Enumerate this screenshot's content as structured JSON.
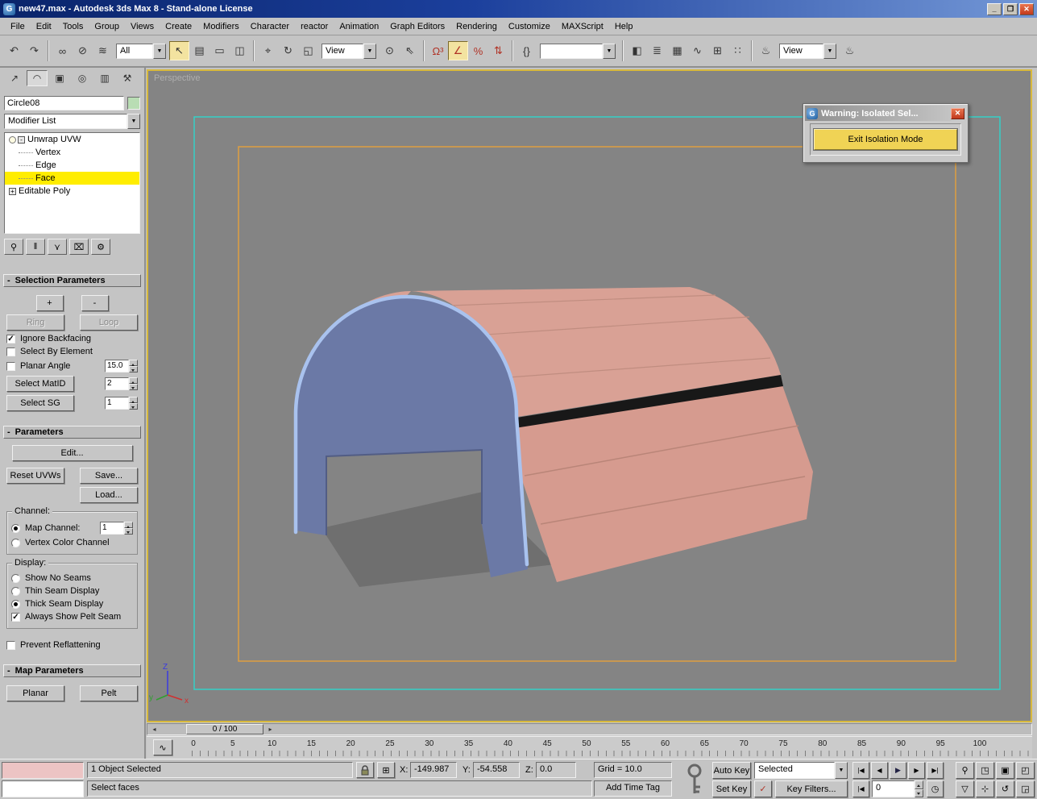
{
  "window": {
    "title": "new47.max - Autodesk 3ds Max 8  - Stand-alone License",
    "icon": "G",
    "minimize": "_",
    "maximize": "❐",
    "close": "✕"
  },
  "menu": {
    "items": [
      "File",
      "Edit",
      "Tools",
      "Group",
      "Views",
      "Create",
      "Modifiers",
      "Character",
      "reactor",
      "Animation",
      "Graph Editors",
      "Rendering",
      "Customize",
      "MAXScript",
      "Help"
    ]
  },
  "glyphs": {
    "dd_arrow": "▼",
    "check": "✓"
  },
  "toolbar": {
    "selection_filter": "All",
    "coord_system": "View",
    "render_view": "View",
    "icons": {
      "undo": "↶",
      "redo": "↷",
      "select_link": "∞",
      "unlink": "⊘",
      "bind_spacewarp": "≋",
      "select_object": "↖",
      "select_by_name": "▤",
      "region": "▭",
      "window_crossing": "◫",
      "move": "⌖",
      "rotate": "↻",
      "scale": "◱",
      "pivot_center": "⊙",
      "manipulate": "⇖",
      "snap_3d": "Ω³",
      "snap_angle": "∠",
      "snap_percent": "%",
      "snap_spinner": "⇅",
      "named_sets": "{}",
      "mirror": "◧",
      "align": "≣",
      "layers": "▦",
      "curve_editor": "∿",
      "schematic": "⊞",
      "material_editor": "∷",
      "render_setup": "♨",
      "quick_render": "♨"
    }
  },
  "panel_tabs": {
    "create": "↗",
    "modify": "◠",
    "hierarchy": "▣",
    "motion": "◎",
    "display": "▥",
    "utilities": "⚒"
  },
  "command_panel": {
    "object_name": "Circle08",
    "modifier_list": "Modifier List",
    "stack": {
      "unwrap": "Unwrap UVW",
      "vertex": "Vertex",
      "edge": "Edge",
      "face": "Face",
      "epoly": "Editable Poly",
      "minus_box": "-",
      "plus_box": "+"
    },
    "stack_tools": {
      "pin": "⚲",
      "show_end": "‖",
      "unique": "⋎",
      "remove": "⌧",
      "config": "⚙"
    },
    "selection_parameters": {
      "title": "Selection Parameters",
      "collapse": "-",
      "plus": "+",
      "minus": "-",
      "ring": "Ring",
      "loop": "Loop",
      "ignore_backfacing": "Ignore Backfacing",
      "ignore_backfacing_checked": true,
      "select_by_element": "Select By Element",
      "select_by_element_checked": false,
      "planar_angle": "Planar Angle",
      "planar_angle_checked": false,
      "planar_angle_value": "15.0",
      "select_matid": "Select MatID",
      "matid_value": "2",
      "select_sg": "Select SG",
      "sg_value": "1"
    },
    "parameters": {
      "title": "Parameters",
      "collapse": "-",
      "edit": "Edit...",
      "reset": "Reset UVWs",
      "save": "Save...",
      "load": "Load...",
      "channel_group": "Channel:",
      "map_channel": "Map Channel:",
      "map_channel_value": "1",
      "map_channel_selected": true,
      "vertex_color": "Vertex Color Channel",
      "display_group": "Display:",
      "show_no_seams": "Show No Seams",
      "thin_seam": "Thin Seam Display",
      "thick_seam": "Thick Seam Display",
      "thick_seam_selected": true,
      "always_pelt": "Always Show Pelt Seam",
      "always_pelt_checked": true,
      "prevent_reflattening": "Prevent Reflattening",
      "prevent_reflattening_checked": false
    },
    "map_parameters": {
      "title": "Map Parameters",
      "collapse": "-",
      "planar": "Planar",
      "pelt": "Pelt"
    }
  },
  "viewport": {
    "label": "Perspective",
    "axis": {
      "x": "x",
      "y": "y",
      "z": "Z"
    }
  },
  "dialog": {
    "title": "Warning: Isolated Sel...",
    "icon": "G",
    "close": "✕",
    "exit_button": "Exit Isolation Mode"
  },
  "trackbar": {
    "value": "0 / 100",
    "prev": "◂",
    "next": "▸",
    "mini_curve": "∿"
  },
  "ruler": {
    "labels": [
      "0",
      "5",
      "10",
      "15",
      "20",
      "25",
      "30",
      "35",
      "40",
      "45",
      "50",
      "55",
      "60",
      "65",
      "70",
      "75",
      "80",
      "85",
      "90",
      "95",
      "100"
    ]
  },
  "status": {
    "selection": "1 Object Selected",
    "prompt": "Select faces",
    "x_label": "X:",
    "x": "-149.987",
    "y_label": "Y:",
    "y": "-54.558",
    "z_label": "Z:",
    "z": "0.0",
    "grid": "Grid = 10.0",
    "time_tag": "Add Time Tag",
    "abs_mode": "⊞",
    "auto_key": "Auto Key",
    "set_key": "Set Key",
    "selected_filter": "Selected",
    "key_filter_toggle": "✓",
    "key_filters": "Key Filters...",
    "playback": {
      "go_start": "|◀",
      "prev": "◀",
      "play": "▶",
      "next": "▶",
      "go_end": "▶|",
      "frame": "0",
      "go_start2": "|◀",
      "time_config": "◷"
    },
    "nav": {
      "zoom": "⚲",
      "zoom_all": "◳",
      "zoom_extents": "▣",
      "zoom_extents_all": "◰",
      "fov": "▽",
      "pan": "⊹",
      "arc_rotate": "↺",
      "min_max": "◲"
    }
  },
  "colors": {
    "stack_selection": "#ffed00",
    "seam_blue": "#a9c2ee",
    "roof_pink": "#d9a195",
    "body_blue": "#6b79a6",
    "warning_button": "#f0d355",
    "safe_frame_teal": "#35d0c6",
    "safe_frame_orange": "#de9f40",
    "active_viewport_border": "#d8b93c"
  }
}
